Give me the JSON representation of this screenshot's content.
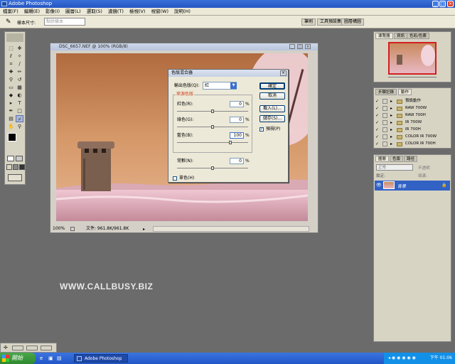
{
  "window": {
    "title": "Adobe Photoshop"
  },
  "menu": [
    "檔案(F)",
    "編輯(E)",
    "影像(I)",
    "圖層(L)",
    "選取(S)",
    "濾鏡(T)",
    "檢視(V)",
    "視窗(W)",
    "說明(H)"
  ],
  "options": {
    "brush_label": "樣本尺寸:",
    "brush_value": "點狀樣本"
  },
  "dock_tabs": [
    "筆刷",
    "工具預設集",
    "圖層構圖"
  ],
  "document": {
    "title": "DSC_6657.NEF @ 100% (RGB/8)",
    "zoom": "100%",
    "doc_size": "文件: 961.8K/961.8K"
  },
  "mixer": {
    "title": "色版混合器",
    "output_label": "輸出色版(Q):",
    "output_value": "紅",
    "group_label": "來源色版",
    "red_label": "紅色(R):",
    "red_value": "0",
    "green_label": "綠色(G):",
    "green_value": "0",
    "blue_label": "藍色(B):",
    "blue_value": "100",
    "constant_label": "常數(N):",
    "constant_value": "0",
    "percent": "%",
    "ok": "確定",
    "cancel": "取消",
    "load": "載入(L)...",
    "save": "儲存(S)...",
    "preview": "預視(P)",
    "mono": "單色(H)",
    "sliders": {
      "red": 0,
      "green": 0,
      "blue": 100,
      "constant": 0
    }
  },
  "navigator": {
    "tabs": [
      "導覽器",
      "資訊",
      "色彩/色票"
    ]
  },
  "actions": {
    "tabs": [
      "步驟記錄",
      "動作"
    ],
    "items": [
      "預設動作",
      "RAW 700W",
      "RAW 700H",
      "IR 700W",
      "IR 700H",
      "COLOR IR 700W",
      "COLOR IR 700H"
    ]
  },
  "layers": {
    "tabs": [
      "圖層",
      "色版",
      "路徑"
    ],
    "blend": "正常",
    "opacity_label": "不透明",
    "opacity_value": "",
    "lock_label": "鎖定:",
    "fill_label": "填滿:",
    "layer_name": "背景"
  },
  "watermark": "WWW.CALLBUSY.BIZ",
  "taskbar": {
    "start": "開始",
    "app": "Adobe Photoshop",
    "clock": "下午 01:06"
  },
  "colors": {
    "accent": "#2556c2",
    "sky": "#c88a5c",
    "ground": "#e8b8c8"
  }
}
